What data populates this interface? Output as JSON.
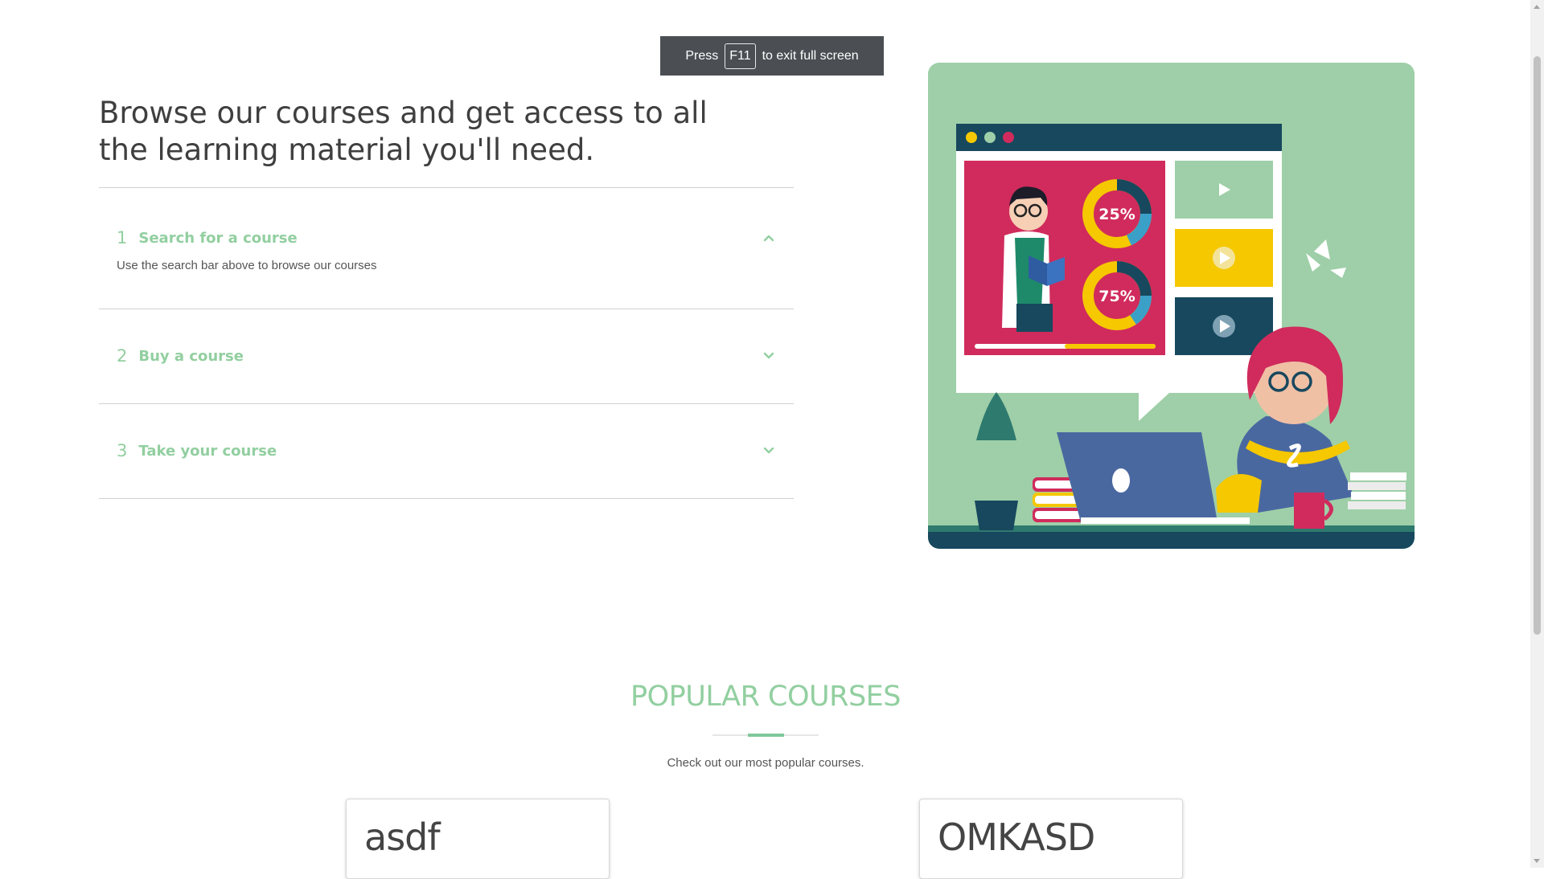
{
  "fullscreen_toast": {
    "press": "Press",
    "key": "F11",
    "suffix": "to exit full screen"
  },
  "headline": "Browse our courses and get access to all the learning material you'll need.",
  "accordion": {
    "items": [
      {
        "number": "1",
        "title": "Search for a course",
        "expanded": true,
        "body": "Use the search bar above to browse our courses",
        "chevron_icon": "chevron-up-icon"
      },
      {
        "number": "2",
        "title": "Buy a course",
        "expanded": false,
        "chevron_icon": "chevron-down-icon"
      },
      {
        "number": "3",
        "title": "Take your course",
        "expanded": false,
        "chevron_icon": "chevron-down-icon"
      }
    ]
  },
  "hero": {
    "chart_percent_top": "25%",
    "chart_percent_bottom": "75%"
  },
  "popular": {
    "title": "POPULAR COURSES",
    "subtitle": "Check out our most popular courses.",
    "courses": [
      {
        "name": "asdf"
      },
      {
        "name": "OMKASD"
      }
    ]
  },
  "colors": {
    "accent_green": "#92cfa0",
    "hero_bg": "#9ecfa8",
    "toast_bg": "#4b4f54",
    "navy": "#17485e",
    "magenta": "#d02b5c",
    "yellow": "#f5c800"
  }
}
